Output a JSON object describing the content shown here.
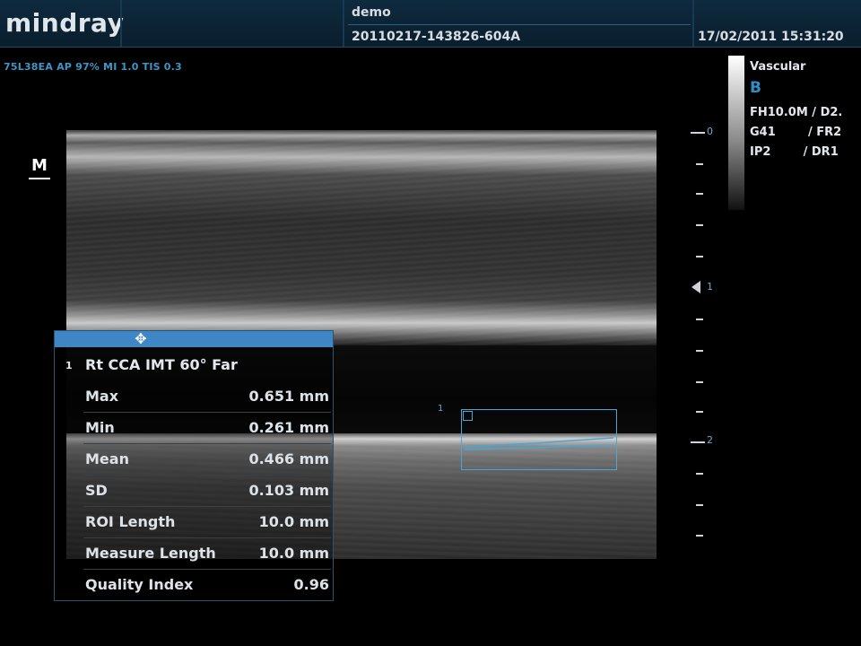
{
  "header": {
    "logo": "mindray",
    "patient_name": "demo",
    "exam_id": "20110217-143826-604A",
    "datetime": "17/02/2011 15:31:20"
  },
  "probe_info": "75L38EA  AP 97%  MI 1.0 TIS 0.3",
  "marker_label": "M",
  "imaging_params": {
    "preset": "Vascular",
    "mode": "B",
    "line1": "FH10.0M / D2.",
    "line2": "G41        / FR2",
    "line3": "IP2        / DR1"
  },
  "depth_ruler": {
    "labels": [
      "0",
      "1",
      "2"
    ],
    "focus_marker": "1"
  },
  "roi": {
    "label": "1"
  },
  "measurement": {
    "index": "1",
    "title": "Rt CCA IMT 60° Far",
    "rows": [
      {
        "label": "Max",
        "value": "0.651 mm"
      },
      {
        "label": "Min",
        "value": "0.261 mm"
      },
      {
        "label": "Mean",
        "value": "0.466 mm"
      },
      {
        "label": "SD",
        "value": "0.103 mm"
      },
      {
        "label": "ROI Length",
        "value": "10.0 mm"
      },
      {
        "label": "Measure Length",
        "value": "10.0 mm"
      },
      {
        "label": "Quality Index",
        "value": "0.96"
      }
    ]
  },
  "colors": {
    "accent": "#3e86c6",
    "header_bg": "#0e2a3e",
    "roi_outline": "#4aa6d6"
  }
}
